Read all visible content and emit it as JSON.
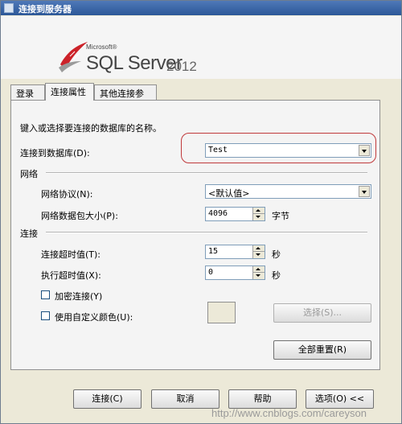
{
  "window": {
    "title": "连接到服务器"
  },
  "banner": {
    "vendor": "Microsoft®",
    "product": "SQL Server",
    "version": "2012"
  },
  "tabs": [
    {
      "label": "登录",
      "active": false
    },
    {
      "label": "连接属性",
      "active": true
    },
    {
      "label": "其他连接参数",
      "active": false
    }
  ],
  "connection_props": {
    "instruction": "键入或选择要连接的数据库的名称。",
    "database_label": "连接到数据库(D):",
    "database_value": "Test",
    "network_group": "网络",
    "protocol_label": "网络协议(N):",
    "protocol_value": "<默认值>",
    "packet_label": "网络数据包大小(P):",
    "packet_value": "4096",
    "packet_unit": "字节",
    "connection_group": "连接",
    "conn_timeout_label": "连接超时值(T):",
    "conn_timeout_value": "15",
    "conn_timeout_unit": "秒",
    "exec_timeout_label": "执行超时值(X):",
    "exec_timeout_value": "0",
    "exec_timeout_unit": "秒",
    "encrypt_label": "加密连接(Y)",
    "encrypt_checked": false,
    "custom_color_label": "使用自定义颜色(U):",
    "custom_color_checked": false,
    "select_button": "选择(S)...",
    "reset_all_button": "全部重置(R)"
  },
  "footer": {
    "connect": "连接(C)",
    "cancel": "取消",
    "help": "帮助",
    "options": "选项(O) <<"
  },
  "watermark": "http://www.cnblogs.com/careyson",
  "colors": {
    "titlebar": "#2c5798",
    "highlight": "#c0393b",
    "logo_red": "#cc2229"
  }
}
